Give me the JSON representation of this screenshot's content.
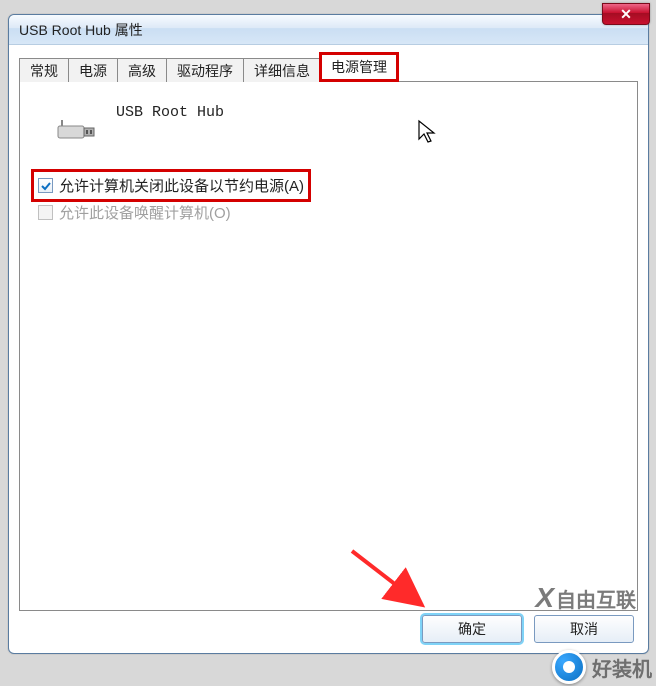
{
  "window": {
    "title": "USB Root Hub 属性"
  },
  "tabs": {
    "t0": "常规",
    "t1": "电源",
    "t2": "高级",
    "t3": "驱动程序",
    "t4": "详细信息",
    "t5": "电源管理"
  },
  "device": {
    "name": "USB Root Hub"
  },
  "checks": {
    "allow_off": "允许计算机关闭此设备以节约电源(A)",
    "allow_wake": "允许此设备唤醒计算机(O)"
  },
  "buttons": {
    "ok": "确定",
    "cancel": "取消"
  },
  "watermarks": {
    "w1": "自由互联",
    "w2": "好装机"
  }
}
